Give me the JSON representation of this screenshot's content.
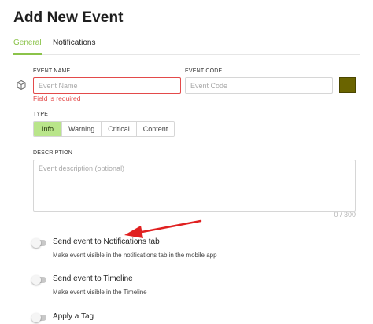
{
  "header": {
    "title": "Add New Event"
  },
  "tabs": [
    {
      "label": "General",
      "active": true
    },
    {
      "label": "Notifications",
      "active": false
    }
  ],
  "form": {
    "event_name": {
      "label": "EVENT NAME",
      "placeholder": "Event Name",
      "value": "",
      "error": "Field is required"
    },
    "event_code": {
      "label": "EVENT CODE",
      "placeholder": "Event Code",
      "value": ""
    },
    "color": "#6a6400",
    "type": {
      "label": "TYPE",
      "options": [
        "Info",
        "Warning",
        "Critical",
        "Content"
      ],
      "selected": "Info"
    },
    "description": {
      "label": "DESCRIPTION",
      "placeholder": "Event description (optional)",
      "counter": "0 / 300"
    }
  },
  "options": [
    {
      "title": "Send event to Notifications tab",
      "description": "Make event visible in the notifications tab in the mobile app",
      "enabled": false
    },
    {
      "title": "Send event to Timeline",
      "description": "Make event visible in the Timeline",
      "enabled": false
    },
    {
      "title": "Apply a Tag",
      "enabled": false
    }
  ],
  "colors": {
    "accent": "#8bc34a",
    "active_segment": "#b9e58a",
    "error": "#e34a4a",
    "annotation_arrow": "#e02020"
  },
  "icons": {
    "event_icon": "cube-icon"
  }
}
